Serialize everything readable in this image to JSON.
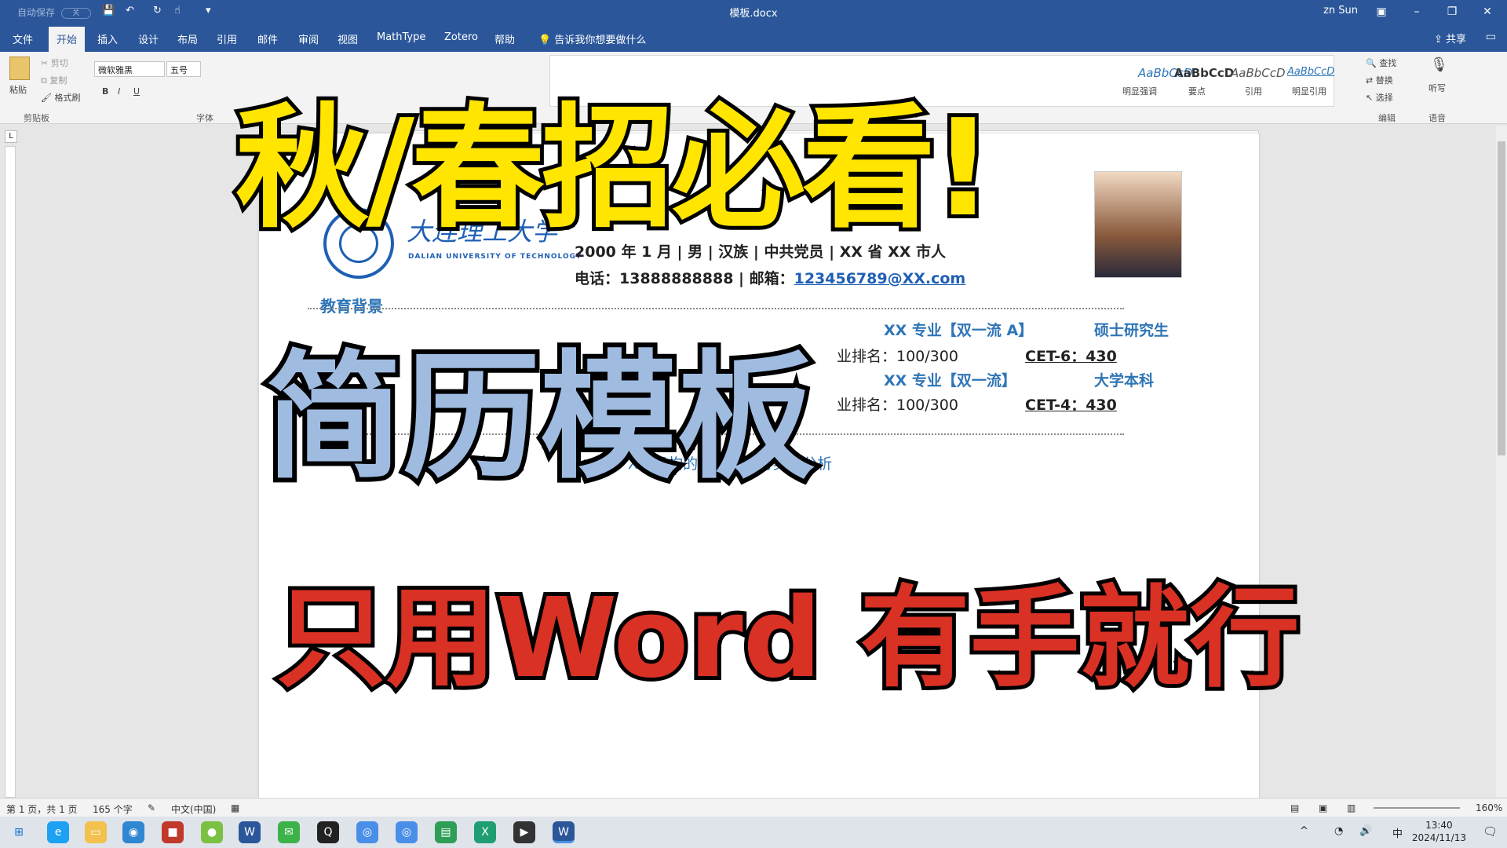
{
  "titlebar": {
    "autosave_label": "自动保存",
    "autosave_state": "关",
    "doc_title": "模板.docx",
    "user": "zn Sun",
    "min": "–",
    "restore": "❐",
    "close": "✕"
  },
  "menu": {
    "tabs": [
      "文件",
      "开始",
      "插入",
      "设计",
      "布局",
      "引用",
      "邮件",
      "审阅",
      "视图",
      "MathType",
      "Zotero",
      "帮助"
    ],
    "tell_me": "告诉我你想要做什么",
    "share": "共享"
  },
  "ribbon": {
    "paste": "粘贴",
    "cut": "剪切",
    "copy": "复制",
    "format_painter": "格式刷",
    "clipboard_label": "剪贴板",
    "font_name": "微软雅黑",
    "font_size": "五号",
    "font_label": "字体",
    "styles": [
      {
        "sample": "AaBbCcD",
        "label": "明显强调"
      },
      {
        "sample": "AaBbCcD",
        "label": "要点"
      },
      {
        "sample": "AaBbCcD",
        "label": "引用"
      },
      {
        "sample": "AaBbCcD",
        "label": "明显引用"
      }
    ],
    "find": "查找",
    "replace": "替换",
    "select": "选择",
    "edit_label": "编辑",
    "dictate": "听写",
    "voice_label": "语音"
  },
  "document": {
    "info_line": "2000 年 1 月 | 男 | 汉族 | 中共党员 | XX 省 XX 市人",
    "contact_prefix": "电话：13888888888 | 邮箱：",
    "email": "123456789@XX.com",
    "logo_cn": "大连理工大学",
    "logo_en": "DALIAN UNIVERSITY OF TECHNOLOGY",
    "section_edu": "教育背景",
    "edu1_major": "XX 专业【双一流 A】",
    "edu1_degree": "硕士研究生",
    "edu1_rank": "业排名：100/300",
    "edu1_cet": "CET-6：430",
    "edu2_major": "XX 专业【双一流】",
    "edu2_degree": "大学本科",
    "edu2_rank": "业排名：100/300",
    "edu2_cet": "CET-4：430",
    "project_start": "202",
    "project_tail": "XX 机构的组织机制与实践分析"
  },
  "overlay": {
    "line1": "秋/春招必看!",
    "line2": "简历模板",
    "line3": "只用Word 有手就行"
  },
  "status": {
    "page": "第 1 页，共 1 页",
    "words": "165 个字",
    "lang": "中文(中国)",
    "zoom": "160%"
  },
  "taskbar": {
    "time": "13:40",
    "date": "2024/11/13",
    "ime": "中"
  }
}
